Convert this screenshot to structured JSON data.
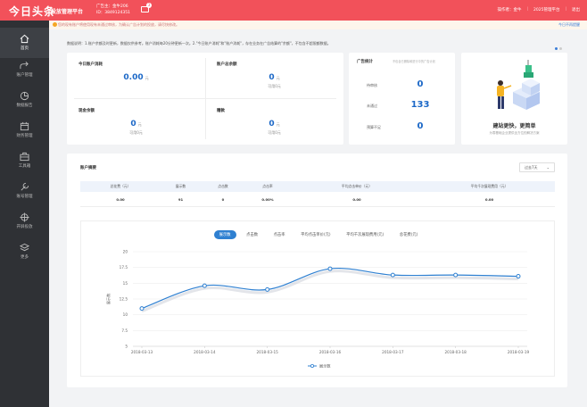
{
  "header": {
    "logo": "今日头条",
    "platform": "投放管理平台",
    "account_line1": "广告主：金牛206",
    "account_line2": "ID：3849124351",
    "msg_count": "3",
    "links": [
      "操作者：金牛",
      "|",
      "2025管理平台",
      "|",
      "退出"
    ]
  },
  "notice": {
    "text": "您的现有账户将使用现有未通过审核，为确认广告计划的投放，请尽快修改。",
    "close_label": "今日不再提醒"
  },
  "sidebar": {
    "items": [
      {
        "label": "首页",
        "icon": "home-icon"
      },
      {
        "label": "账户管理",
        "icon": "share-icon"
      },
      {
        "label": "数据报告",
        "icon": "pie-chart-icon"
      },
      {
        "label": "财务管理",
        "icon": "calendar-icon"
      },
      {
        "label": "工具箱",
        "icon": "toolbox-icon"
      },
      {
        "label": "账号管理",
        "icon": "wrench-icon"
      },
      {
        "label": "开屏投放",
        "icon": "crosshair-icon"
      },
      {
        "label": "更多",
        "icon": "layers-icon"
      }
    ]
  },
  "intro": "数据说明：1.账户余额及时更新，数据仅供参考。账户消耗每20分钟更新一次。2.\"今日账户消耗\"和\"账户消耗\"，存在业务在广告结算的\"余额\"，不包含不超限额数据。",
  "balance": {
    "today_consume": {
      "title": "今日账户消耗",
      "value": "0.00",
      "unit": "元"
    },
    "account_total": {
      "title": "账户总余额",
      "value": "0",
      "unit": "元",
      "sub": "可用0元"
    },
    "cash": {
      "title": "现金余额",
      "value": "0",
      "unit": "元",
      "sub": "可用0元"
    },
    "grant": {
      "title": "赠款",
      "value": "0",
      "unit": "元",
      "sub": "可用0元"
    }
  },
  "ad_stats": {
    "title": "广告统计",
    "hint": "不包含已删除和进行中的广告计划",
    "rows": [
      {
        "label": "待审核",
        "value": "0"
      },
      {
        "label": "未通过",
        "value": "133"
      },
      {
        "label": "预算不足",
        "value": "0"
      }
    ]
  },
  "promo": {
    "title": "建站更快，更简单",
    "subtitle": "为零基础企业提供全方位的解决方案"
  },
  "data_section": {
    "title": "账户摘要",
    "period": "过去7天",
    "headers": [
      "总花费（元）",
      "展示数",
      "点击数",
      "点击率",
      "平均点击单价（元）",
      "平均千次展现费用（元）"
    ],
    "values": [
      "0.00",
      "91",
      "0",
      "0.00%",
      "0.00",
      "0.00"
    ],
    "tabs": [
      "展示数",
      "点击数",
      "点击率",
      "平均点击单价(元)",
      "平均千次展现费用(元)",
      "总花费(元)"
    ],
    "active_tab": 0
  },
  "chart_data": {
    "type": "line",
    "x": [
      "2018-03-13",
      "2018-03-14",
      "2018-03-15",
      "2018-03-16",
      "2018-03-17",
      "2018-03-18",
      "2018-03-19"
    ],
    "series": [
      {
        "name": "展示数",
        "values": [
          11,
          14.6,
          14,
          17.3,
          16.3,
          16.3,
          16.1
        ]
      }
    ],
    "ylabel": "展示数",
    "ylim": [
      5,
      20
    ],
    "yticks": [
      5,
      7.5,
      10,
      12.5,
      15,
      17.5,
      20
    ],
    "grid": true,
    "legend": "bottom",
    "color": "#2f80d1"
  }
}
